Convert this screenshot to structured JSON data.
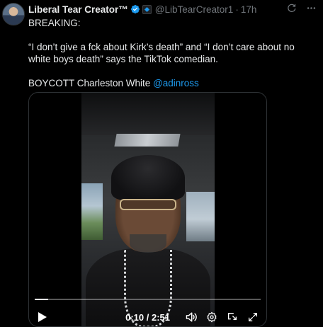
{
  "post": {
    "author_name": "Liberal Tear Creator™",
    "handle": "@LibTearCreator1",
    "separator": "·",
    "time": "17h",
    "text": {
      "line1": "BREAKING:",
      "line2": "“I don’t give a fck about Kirk’s death” and “I don’t care about no white boys death” says the TikTok comedian.",
      "line3_prefix": "BOYCOTT Charleston White ",
      "line3_mention": "@adinross"
    }
  },
  "icons": {
    "verified": "verified-badge-icon",
    "affiliate": "affiliate-badge-icon",
    "grok": "grok-icon",
    "more": "more-icon"
  },
  "video": {
    "current_time": "0:10",
    "duration": "2:51",
    "time_separator": " / ",
    "progress_fraction": 0.058
  },
  "colors": {
    "background": "#000000",
    "text": "#e7e9ea",
    "muted": "#71767b",
    "accent": "#1d9bf0"
  }
}
